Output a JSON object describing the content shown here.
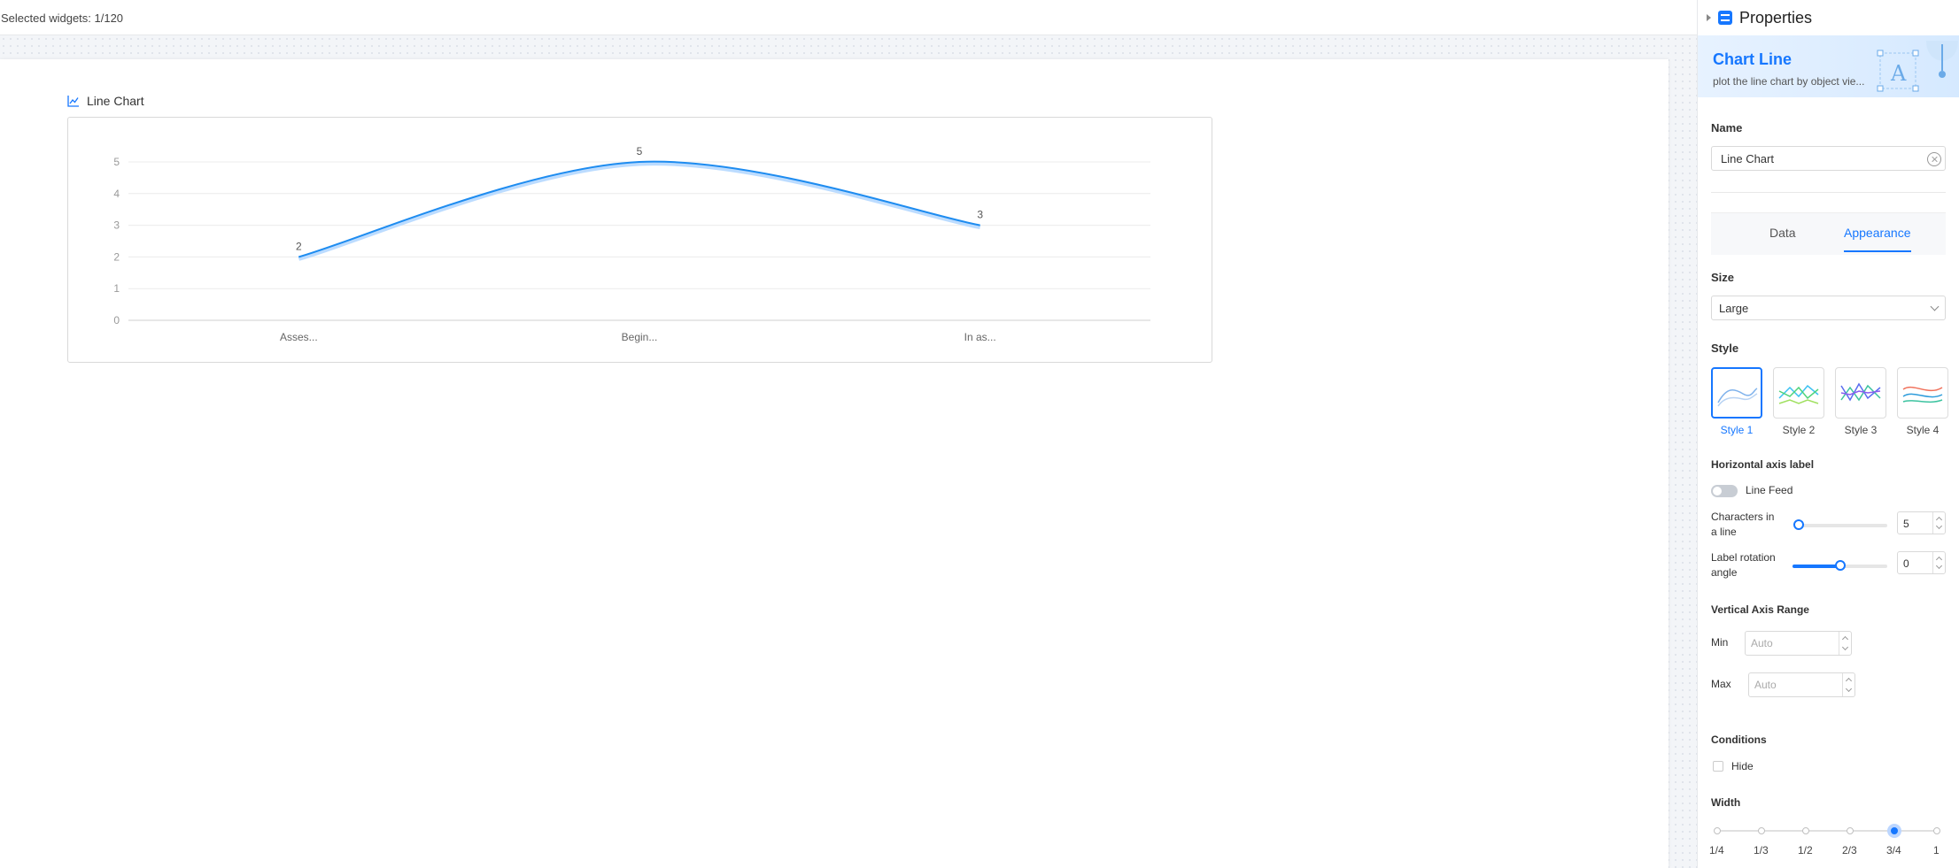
{
  "topbar": {
    "selected_text": "Selected widgets: 1/120"
  },
  "widget": {
    "title": "Line Chart"
  },
  "chart_data": {
    "type": "line",
    "categories": [
      "Asses...",
      "Begin...",
      "In as..."
    ],
    "values": [
      2,
      5,
      3
    ],
    "ylim": [
      0,
      5
    ],
    "yticks": [
      0,
      1,
      2,
      3,
      4,
      5
    ],
    "grid": true,
    "smooth": true,
    "color": "#1e8cf0"
  },
  "panel": {
    "title": "Properties",
    "banner": {
      "title": "Chart Line",
      "subtitle": "plot the line chart by object vie..."
    },
    "name": {
      "label": "Name",
      "value": "Line Chart"
    },
    "tabs": [
      {
        "label": "Data"
      },
      {
        "label": "Appearance"
      }
    ],
    "active_tab": "Appearance",
    "size": {
      "label": "Size",
      "value": "Large"
    },
    "style": {
      "label": "Style",
      "options": [
        "Style 1",
        "Style 2",
        "Style 3",
        "Style 4"
      ],
      "selected": "Style 1"
    },
    "haxis": {
      "label": "Horizontal axis label",
      "line_feed": {
        "label": "Line Feed",
        "on": false
      },
      "chars": {
        "label_1": "Characters in",
        "label_2": "a line",
        "value": "5",
        "slider_fraction": 0.0
      },
      "rotation": {
        "label_1": "Label rotation",
        "label_2": "angle",
        "value": "0",
        "slider_fraction": 0.5
      }
    },
    "vrange": {
      "label": "Vertical Axis Range",
      "min": {
        "label": "Min",
        "placeholder": "Auto"
      },
      "max": {
        "label": "Max",
        "placeholder": "Auto"
      }
    },
    "conditions": {
      "label": "Conditions",
      "hide": {
        "label": "Hide",
        "checked": false
      }
    },
    "width": {
      "label": "Width",
      "options": [
        "1/4",
        "1/3",
        "1/2",
        "2/3",
        "3/4",
        "1"
      ],
      "selected": "3/4"
    }
  }
}
